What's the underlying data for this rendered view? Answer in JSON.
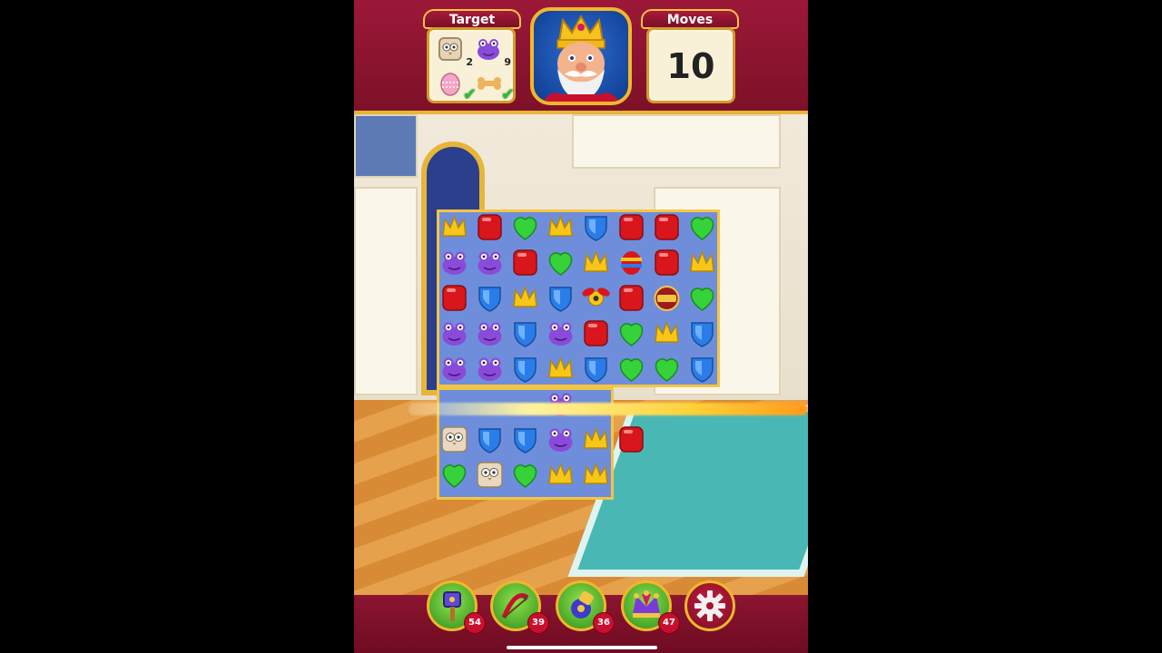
{
  "target": {
    "title": "Target",
    "items": [
      {
        "icon": "owl-block-icon",
        "count": "2"
      },
      {
        "icon": "frog-icon",
        "count": "9"
      },
      {
        "icon": "pink-egg-icon",
        "done": true
      },
      {
        "icon": "bone-icon",
        "done": true
      }
    ]
  },
  "moves": {
    "title": "Moves",
    "value": "10"
  },
  "king": {
    "icon": "king-portrait-icon"
  },
  "boosters": [
    {
      "icon": "hammer-booster-icon",
      "count": "54"
    },
    {
      "icon": "arrow-booster-icon",
      "count": "39"
    },
    {
      "icon": "cannon-booster-icon",
      "count": "36"
    },
    {
      "icon": "jester-hat-booster-icon",
      "count": "47"
    }
  ],
  "settings": {
    "icon": "gear-icon"
  },
  "colors": {
    "red": "#d8161c",
    "green": "#35d23a",
    "yellow": "#f7c61a",
    "blue": "#2a7de8",
    "purple": "#8a4bd8",
    "owl": "#e8d8c0"
  },
  "board": {
    "rows": [
      [
        "crown",
        "red",
        "leaf",
        "crown",
        "shield",
        "red",
        "red",
        "leaf"
      ],
      [
        "frog",
        "frog",
        "red",
        "leaf",
        "crown",
        "striped-egg",
        "red",
        "crown"
      ],
      [
        "red",
        "shield",
        "crown",
        "shield",
        "propeller",
        "red",
        "tnt",
        "leaf"
      ],
      [
        "frog",
        "frog",
        "shield",
        "frog",
        "red",
        "leaf",
        "crown",
        "shield"
      ],
      [
        "frog",
        "frog",
        "shield",
        "crown",
        "shield",
        "leaf",
        "leaf",
        "shield"
      ],
      [
        "",
        "",
        "",
        "frog",
        "",
        "",
        "",
        ""
      ],
      [
        "owl",
        "shield",
        "shield",
        "frog",
        "crown",
        "red",
        "",
        ""
      ],
      [
        "leaf",
        "owl",
        "leaf",
        "crown",
        "crown",
        "",
        "",
        ""
      ]
    ]
  }
}
